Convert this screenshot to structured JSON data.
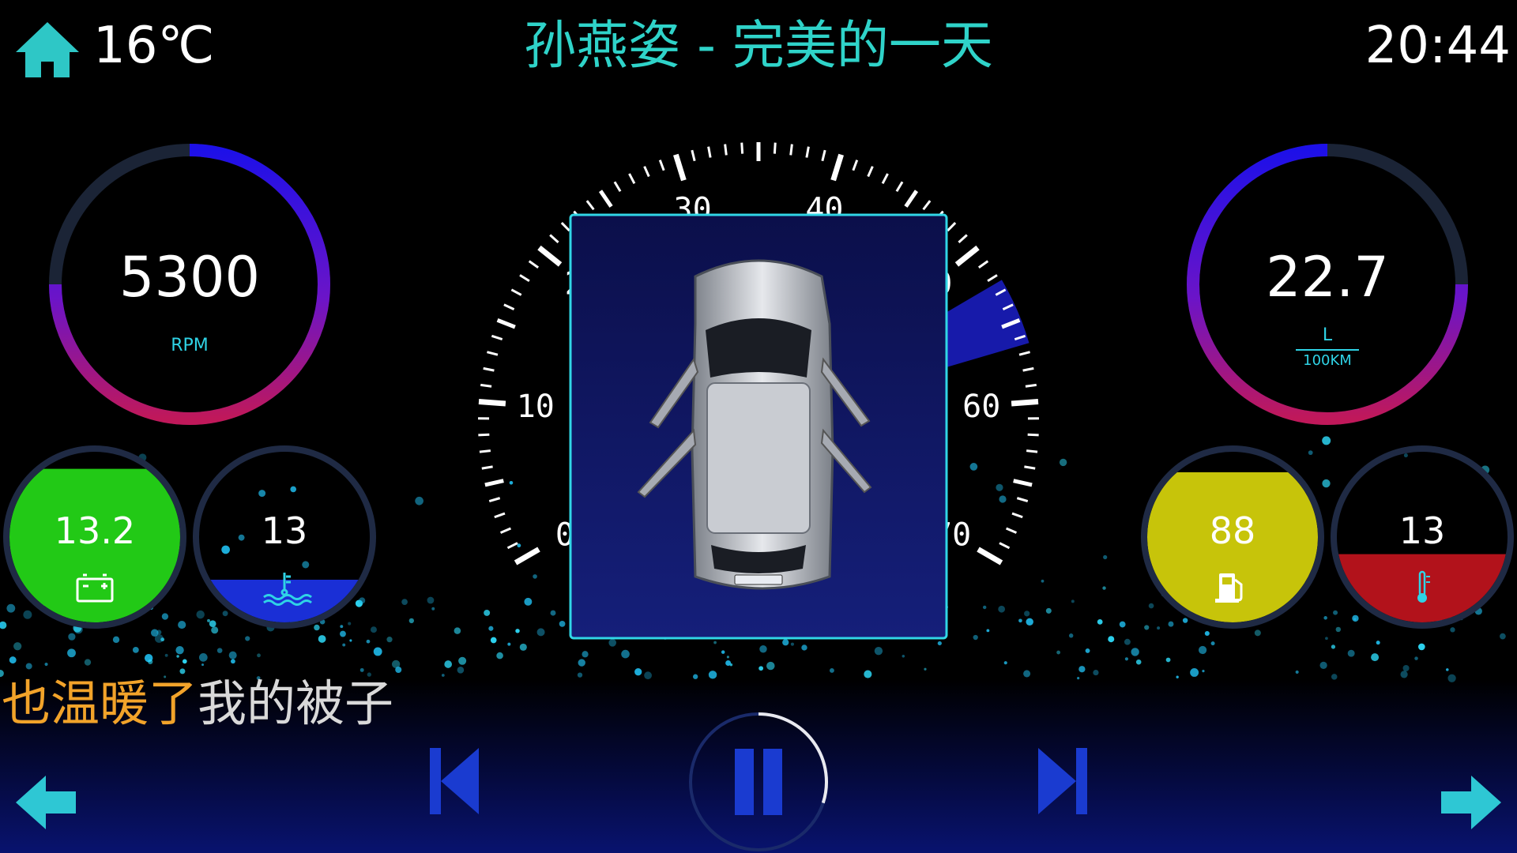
{
  "header": {
    "temperature": "16℃",
    "song_title": "孙燕姿 - 完美的一天",
    "clock": "20:44"
  },
  "rpm_gauge": {
    "value": "5300",
    "unit": "RPM",
    "fill_fraction": 0.75
  },
  "consumption_gauge": {
    "value": "22.7",
    "unit_top": "L",
    "unit_bottom": "100KM",
    "fill_fraction": 0.75
  },
  "speedometer": {
    "tick_labels": [
      "0",
      "10",
      "20",
      "30",
      "40",
      "50",
      "60",
      "70"
    ],
    "current_speed_fraction": 0.79
  },
  "battery_gauge": {
    "value": "13.2",
    "level": 0.9
  },
  "coolant_gauge": {
    "value": "13",
    "level": 0.25
  },
  "fuel_gauge": {
    "value": "88",
    "level": 0.88
  },
  "outside_temp_gauge": {
    "value": "13",
    "level": 0.4
  },
  "lyric": {
    "sung": "也温暖了",
    "remaining": "我的被子"
  },
  "playback": {
    "state": "playing",
    "progress": 0.3
  },
  "icons": {
    "home": "home-icon",
    "battery": "battery-icon",
    "coolant": "coolant-temperature-icon",
    "fuel": "fuel-pump-icon",
    "thermometer": "thermometer-icon",
    "previous": "skip-previous-icon",
    "pause": "pause-icon",
    "next": "skip-next-icon",
    "back": "arrow-left-icon",
    "forward": "arrow-right-icon"
  },
  "colors": {
    "accent": "#2fd3c9",
    "battery": "#22c916",
    "coolant": "#1a2fd6",
    "fuel": "#c7c40a",
    "outside_temp": "#b2121b",
    "ring_start": "#1d10e8",
    "ring_end": "#c0185a"
  }
}
